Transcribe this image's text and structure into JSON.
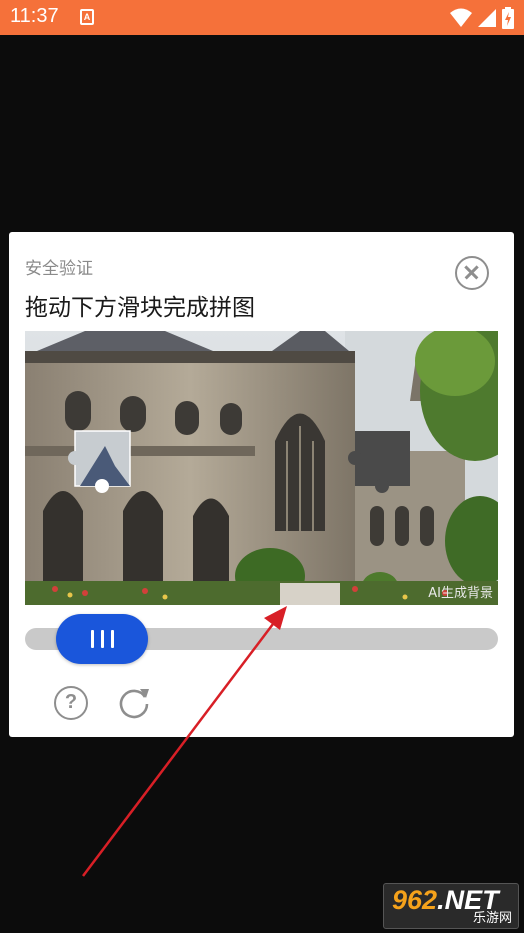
{
  "statusbar": {
    "time": "11:37",
    "notification_icon": "A",
    "icons": [
      "wifi-icon",
      "signal-icon",
      "battery-charging-icon"
    ],
    "bg_color": "#f5713a"
  },
  "dialog": {
    "subtitle": "安全验证",
    "title": "拖动下方滑块完成拼图",
    "close_icon": "close-circle-icon",
    "image_watermark": "AI生成背景",
    "slider_position_fraction": 0.0,
    "help_icon_text": "?",
    "refresh_icon": "refresh-icon",
    "accent_color": "#1a56db"
  },
  "annotation": {
    "color": "#d81f26"
  },
  "brand": {
    "prefix": "9",
    "digits": "62",
    "suffix": ".NET",
    "sub": "乐游网"
  }
}
